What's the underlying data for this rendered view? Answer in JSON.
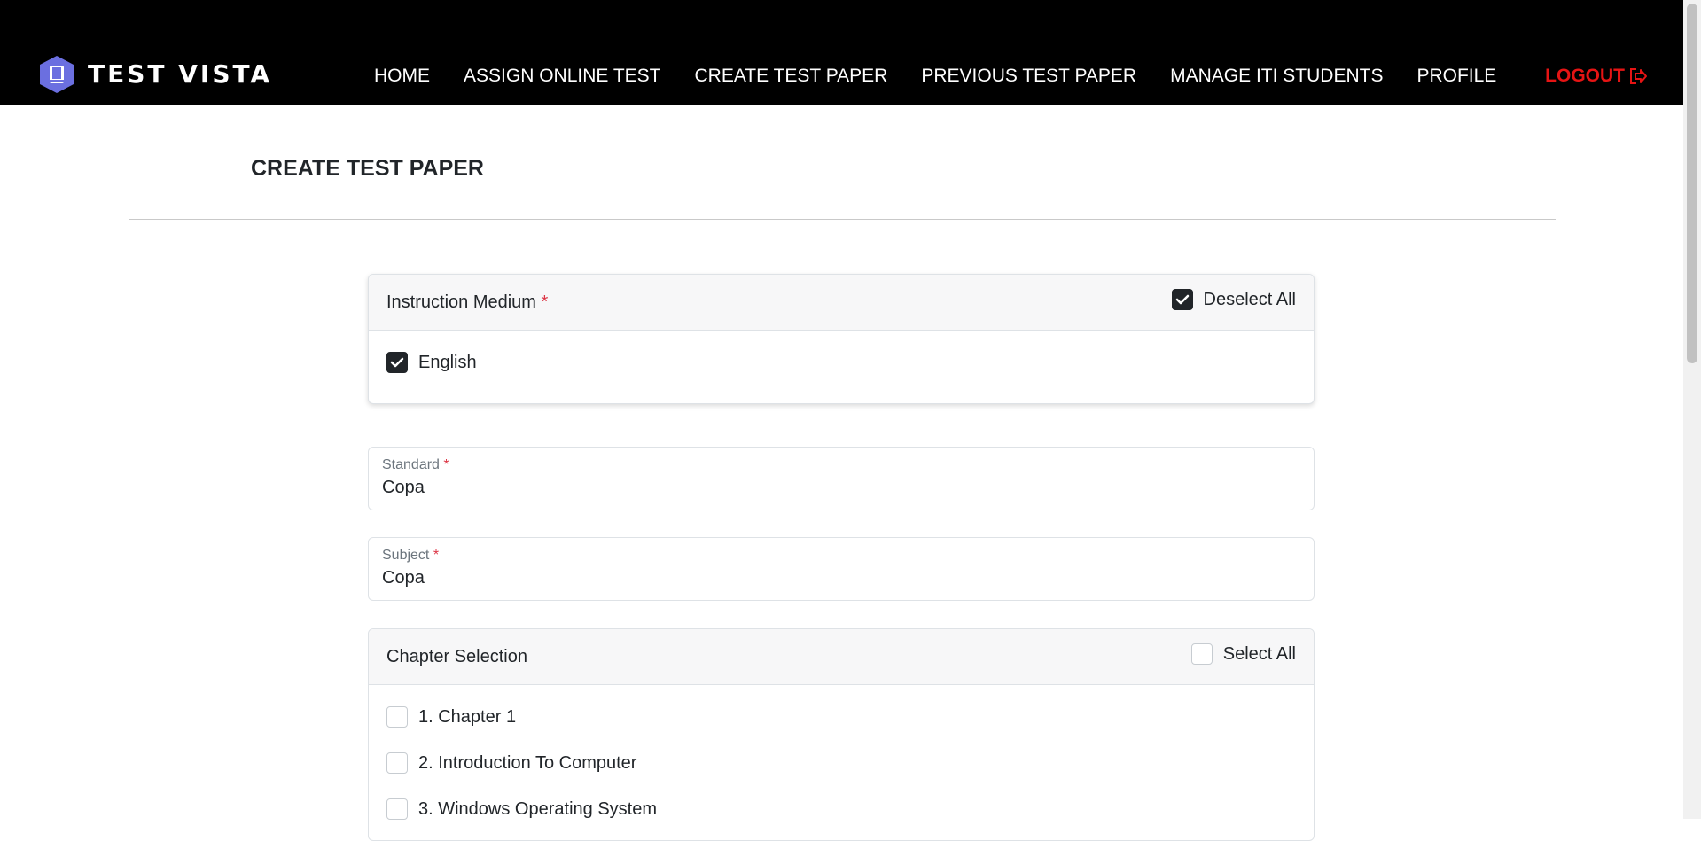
{
  "brand": {
    "name": "TEST VISTA",
    "logo_icon": "book-logo-icon",
    "logo_color": "#6b6fe0"
  },
  "nav": {
    "items": [
      {
        "label": "HOME"
      },
      {
        "label": "ASSIGN ONLINE TEST"
      },
      {
        "label": "CREATE TEST PAPER"
      },
      {
        "label": "PREVIOUS TEST PAPER"
      },
      {
        "label": "MANAGE ITI STUDENTS"
      },
      {
        "label": "PROFILE"
      }
    ],
    "logout_label": "LOGOUT",
    "logout_color": "#e61414"
  },
  "page": {
    "title": "CREATE TEST PAPER"
  },
  "instruction_medium": {
    "title": "Instruction Medium",
    "required_mark": "*",
    "toggle_label": "Deselect All",
    "toggle_checked": true,
    "options": [
      {
        "label": "English",
        "checked": true
      }
    ]
  },
  "standard": {
    "label": "Standard",
    "required_mark": "*",
    "value": "Copa"
  },
  "subject": {
    "label": "Subject",
    "required_mark": "*",
    "value": "Copa"
  },
  "chapter_selection": {
    "title": "Chapter Selection",
    "toggle_label": "Select All",
    "toggle_checked": false,
    "chapters": [
      {
        "label": "1. Chapter 1",
        "checked": false
      },
      {
        "label": "2. Introduction To Computer",
        "checked": false
      },
      {
        "label": "3. Windows Operating System",
        "checked": false
      }
    ]
  }
}
